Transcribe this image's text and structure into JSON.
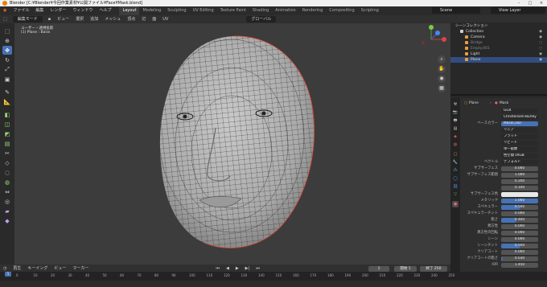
{
  "title": "Blender [C:¥Blender¥今回作業素材¥公開ファイル¥Face¥Mask.blend]",
  "menus": [
    "ファイル",
    "編集",
    "レンダー",
    "ウィンドウ",
    "ヘルプ"
  ],
  "workspaces": [
    "Layout",
    "Modeling",
    "Sculpting",
    "UV Editing",
    "Texture Paint",
    "Shading",
    "Animation",
    "Rendering",
    "Compositing",
    "Scripting"
  ],
  "active_workspace": "Layout",
  "scene": "Scene",
  "view_layer": "View Layer",
  "header": {
    "mode": "編集モード",
    "items": [
      "ビュー",
      "選択",
      "追加",
      "メッシュ",
      "頂点",
      "辺",
      "面",
      "UV"
    ],
    "transform": "グローバル"
  },
  "viewport": {
    "line1": "ユーザー・透視投影",
    "line2": "(1) Plane : Basis"
  },
  "outliner": {
    "header": "シーンコレクション",
    "rows": [
      {
        "label": "Collection",
        "color": "#cfcfcf"
      },
      {
        "label": "Camera",
        "color": "#7fb0e0"
      },
      {
        "label": "Bridge",
        "color": "#888888"
      },
      {
        "label": "Empty.001",
        "color": "#888888"
      },
      {
        "label": "Light",
        "color": "#e0c060"
      },
      {
        "label": "Plane",
        "color": "#e8a040"
      }
    ]
  },
  "properties": {
    "object": "Plane",
    "material": "Mask",
    "slot": "Mask",
    "rows": [
      {
        "label": "",
        "value": "GGX",
        "style": "dark"
      },
      {
        "label": "",
        "value": "Christensen-Burley",
        "style": "dark"
      },
      {
        "label": "ベースカラー",
        "value": "MaskColor",
        "style": "blue-full"
      },
      {
        "label": "",
        "value": "リニア",
        "style": "dark"
      },
      {
        "label": "",
        "value": "フラット",
        "style": "dark"
      },
      {
        "label": "",
        "value": "リピート",
        "style": "dark"
      },
      {
        "label": "",
        "value": "単一画像",
        "style": "dark"
      },
      {
        "label": "",
        "value": "色空間 sRGB",
        "style": "dark"
      },
      {
        "label": "ベクトル",
        "value": "デフォルト",
        "style": "dark"
      },
      {
        "label": "サブサーフェス",
        "value": "0.000",
        "fill": 0
      },
      {
        "label": "サブサーフェス範囲",
        "value": "1.000",
        "fill": 0
      },
      {
        "label": "",
        "value": "0.200",
        "fill": 0
      },
      {
        "label": "",
        "value": "0.100",
        "fill": 0
      },
      {
        "label": "サブサーフェス色",
        "value": "",
        "style": "white"
      },
      {
        "label": "メタリック",
        "value": "1.000",
        "fill": 100
      },
      {
        "label": "スペキュラー",
        "value": "0.500",
        "fill": 50
      },
      {
        "label": "スペキュラーチント",
        "value": "0.000",
        "fill": 0
      },
      {
        "label": "粗さ",
        "value": "0.400",
        "fill": 40
      },
      {
        "label": "異方性",
        "value": "0.000",
        "fill": 0
      },
      {
        "label": "異方性の回転",
        "value": "0.000",
        "fill": 0
      },
      {
        "label": "シーン",
        "value": "0.000",
        "fill": 0
      },
      {
        "label": "シーンチント",
        "value": "0.500",
        "fill": 50
      },
      {
        "label": "クリアコート",
        "value": "0.000",
        "fill": 0
      },
      {
        "label": "クリアコートの粗さ",
        "value": "0.030",
        "fill": 3
      },
      {
        "label": "IOR",
        "value": "1.450",
        "fill": 0
      }
    ]
  },
  "timeline": {
    "menus": [
      "再生",
      "キーイング",
      "ビュー",
      "マーカー"
    ],
    "current": "1",
    "start_label": "開始",
    "start": "1",
    "end_label": "終了",
    "end": "250",
    "ticks": [
      "0",
      "10",
      "20",
      "30",
      "40",
      "50",
      "60",
      "70",
      "80",
      "90",
      "100",
      "110",
      "120",
      "130",
      "140",
      "150",
      "160",
      "170",
      "180",
      "190",
      "200",
      "210",
      "220",
      "230",
      "240",
      "250"
    ]
  }
}
